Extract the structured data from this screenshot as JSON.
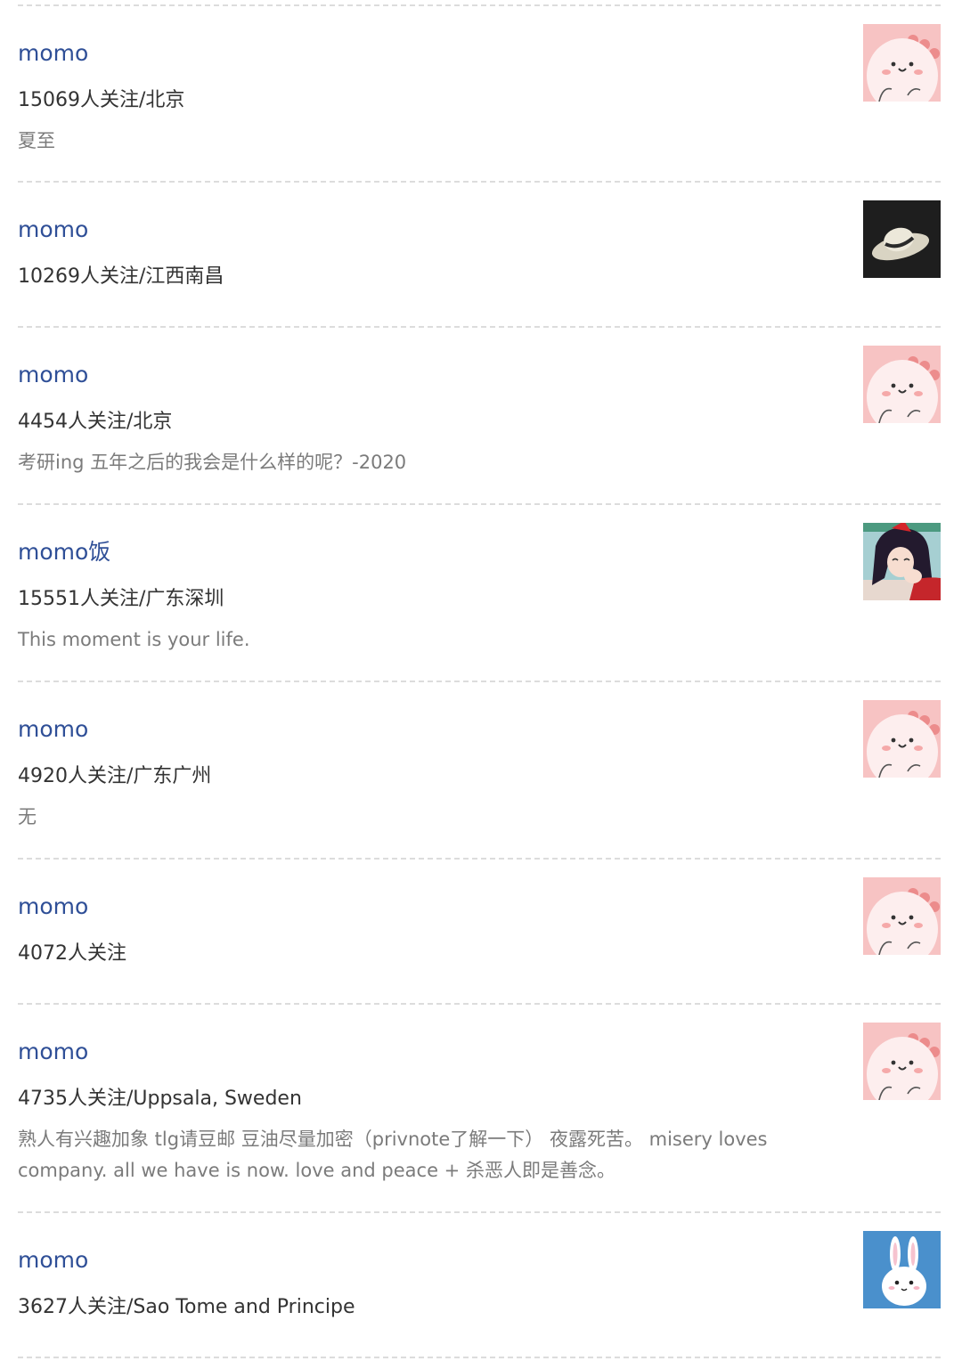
{
  "users": [
    {
      "name": "momo",
      "followers": "15069人关注/北京",
      "bio": "夏至",
      "avatar": "pink-blob-avatar"
    },
    {
      "name": "momo",
      "followers": "10269人关注/江西南昌",
      "bio": "",
      "avatar": "hat-avatar"
    },
    {
      "name": "momo",
      "followers": "4454人关注/北京",
      "bio": "考研ing 五年之后的我会是什么样的呢？-2020",
      "avatar": "pink-blob-avatar"
    },
    {
      "name": "momo饭",
      "followers": "15551人关注/广东深圳",
      "bio": "This moment is your life.",
      "avatar": "anime-girl-avatar"
    },
    {
      "name": "momo",
      "followers": "4920人关注/广东广州",
      "bio": "无",
      "avatar": "pink-blob-avatar"
    },
    {
      "name": "momo",
      "followers": "4072人关注",
      "bio": "",
      "avatar": "pink-blob-avatar"
    },
    {
      "name": "momo",
      "followers": "4735人关注/Uppsala, Sweden",
      "bio": "熟人有兴趣加象 tlg请豆邮 豆油尽量加密（privnote了解一下） 夜露死苦。 misery loves company. all we have is now. love and peace + 杀恶人即是善念。",
      "avatar": "pink-blob-avatar"
    },
    {
      "name": "momo",
      "followers": "3627人关注/Sao Tome and Principe",
      "bio": "",
      "avatar": "bunny-avatar"
    }
  ]
}
